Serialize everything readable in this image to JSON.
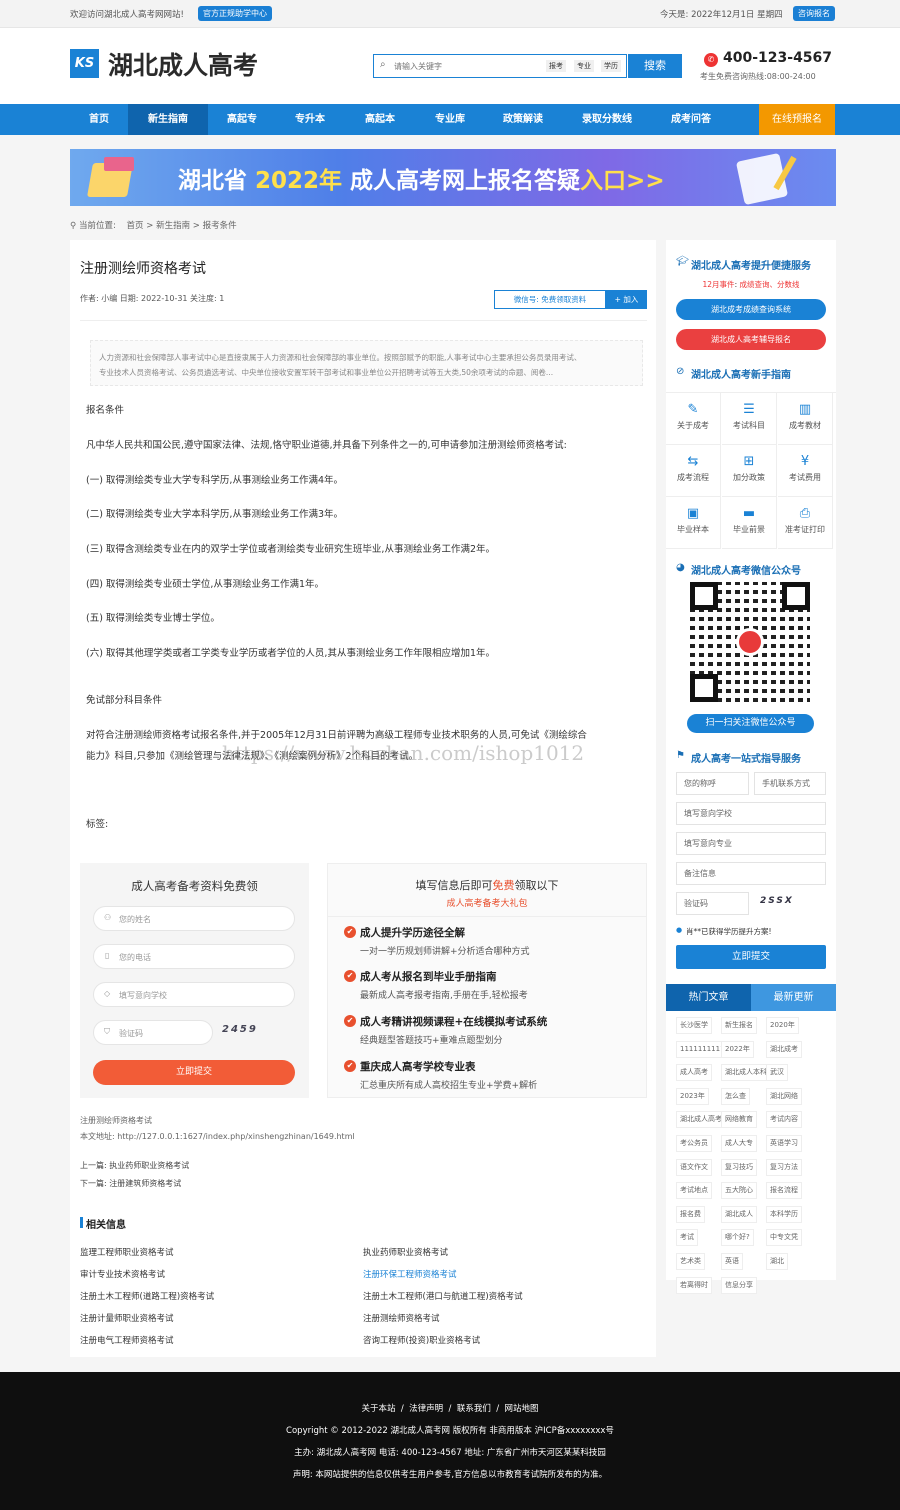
{
  "topbar": {
    "welcome": "欢迎访问湖北成人高考网网站!",
    "official_btn": "官方正规助学中心",
    "date": "今天是: 2022年12月1日 星期四",
    "consult_btn": "咨询报名"
  },
  "header": {
    "logo_mark": "KS",
    "site_name": "湖北成人高考",
    "search_placeholder": "请输入关键字",
    "search_tags": [
      "报考",
      "专业",
      "学历"
    ],
    "search_btn": "搜索",
    "phone": "400-123-4567",
    "hotline": "考生免费咨询热线:08:00-24:00"
  },
  "nav": {
    "items": [
      "首页",
      "新生指南",
      "高起专",
      "专升本",
      "高起本",
      "专业库",
      "政策解读",
      "录取分数线",
      "成考问答"
    ],
    "active_index": 1,
    "cta": "在线预报名"
  },
  "banner": {
    "text_prefix": "湖北省",
    "text_year": "2022年",
    "text_main": "成人高考网上报名答疑",
    "text_link": "入口>>"
  },
  "breadcrumb": {
    "label": "当前位置:",
    "home": "首页",
    "section": "新生指南",
    "current": "报考条件",
    "sep": ">"
  },
  "article": {
    "title": "注册测绘师资格考试",
    "meta": "作者: 小编 日期: 2022-10-31 关注度: 1",
    "wechat_label": "微信号: 免费领取资料",
    "add_btn": "+ 加入",
    "summary_lines": [
      "人力资源和社会保障部人事考试中心是直接隶属于人力资源和社会保障部的事业单位。按照部赋予的职能,人事考试中心主要承担公务员录用考试、",
      "专业技术人员资格考试、公务员遴选考试、中央单位接收安置军转干部考试和事业单位公开招聘考试等五大类,50余项考试的命题、阅卷..."
    ],
    "heading1": "报名条件",
    "intro": "凡中华人民共和国公民,遵守国家法律、法规,恪守职业道德,并具备下列条件之一的,可申请参加注册测绘师资格考试:",
    "conditions": [
      "(一) 取得测绘类专业大学专科学历,从事测绘业务工作满4年。",
      "(二) 取得测绘类专业大学本科学历,从事测绘业务工作满3年。",
      "(三) 取得含测绘类专业在内的双学士学位或者测绘类专业研究生班毕业,从事测绘业务工作满2年。",
      "(四) 取得测绘类专业硕士学位,从事测绘业务工作满1年。",
      "(五) 取得测绘类专业博士学位。",
      "(六) 取得其他理学类或者工学类专业学历或者学位的人员,其从事测绘业务工作年限相应增加1年。"
    ],
    "heading2": "免试部分科目条件",
    "exempt_line1": "对符合注册测绘师资格考试报名条件,并于2005年12月31日前评聘为高级工程师专业技术职务的人员,可免试《测绘综合",
    "exempt_line2": "能力》科目,只参加《测绘管理与法律法规》、《测绘案例分析》2个科目的考试。",
    "watermark": "https://www.huzhan.com/ishop1012",
    "tags_label": "标签:"
  },
  "form": {
    "title": "成人高考备考资料免费领",
    "name_ph": "您的姓名",
    "phone_ph": "您的电话",
    "school_ph": "填写意向学校",
    "captcha_ph": "验证码",
    "captcha_img": "2459",
    "submit": "立即提交"
  },
  "gifts": {
    "title_prefix": "填写信息后即可",
    "title_hl": "免费",
    "title_suffix": "领取以下",
    "subtitle": "成人高考备考大礼包",
    "items": [
      {
        "h": "成人提升学历途径全解",
        "d": "一对一学历规划师讲解+分析适合哪种方式"
      },
      {
        "h": "成人考从报名到毕业手册指南",
        "d": "最新成人高考报考指南,手册在手,轻松报考"
      },
      {
        "h": "成人考精讲视频课程+在线模拟考试系统",
        "d": "经典题型答题技巧+重难点题型划分"
      },
      {
        "h": "重庆成人高考学校专业表",
        "d": "汇总重庆所有成人高校招生专业+学费+解析"
      }
    ]
  },
  "meta_block": {
    "page_title": "注册测绘师资格考试",
    "address": "本文地址: http://127.0.0.1:1627/index.php/xinshengzhinan/1649.html",
    "prev": "上一篇: 执业药师职业资格考试",
    "next": "下一篇: 注册建筑师资格考试"
  },
  "related": {
    "title": "相关信息",
    "left": [
      "监理工程师职业资格考试",
      "审计专业技术资格考试",
      "注册土木工程师(道路工程)资格考试",
      "注册计量师职业资格考试",
      "注册电气工程师资格考试"
    ],
    "right": [
      "执业药师职业资格考试",
      "注册环保工程师资格考试",
      "注册土木工程师(港口与航道工程)资格考试",
      "注册测绘师资格考试",
      "咨询工程师(投资)职业资格考试"
    ]
  },
  "sidebar": {
    "service_title": "湖北成人高考提升便捷服务",
    "notice_month": "12月事件",
    "notice_links": "成绩查询、分数线",
    "query_btn": "湖北成考成绩查询系统",
    "coach_btn": "湖北成人高考辅导报名",
    "guide_title": "湖北成人高考新手指南",
    "grid": [
      {
        "icon": "✎",
        "label": "关于成考"
      },
      {
        "icon": "☰",
        "label": "考试科目"
      },
      {
        "icon": "▥",
        "label": "成考教材"
      },
      {
        "icon": "⇆",
        "label": "成考流程"
      },
      {
        "icon": "⊞",
        "label": "加分政策"
      },
      {
        "icon": "¥",
        "label": "考试费用"
      },
      {
        "icon": "▣",
        "label": "毕业样本"
      },
      {
        "icon": "▬",
        "label": "毕业前景"
      },
      {
        "icon": "⎙",
        "label": "准考证打印"
      }
    ],
    "wechat_title": "湖北成人高考微信公众号",
    "qr_btn": "扫一扫关注微信公众号",
    "onestop_title": "成人高考一站式指导服务",
    "fields": {
      "name": "您的称呼",
      "phone": "手机联系方式",
      "school": "填写意向学校",
      "major": "填写意向专业",
      "remark": "备注信息",
      "captcha": "验证码"
    },
    "captcha_img": "2SSX",
    "success_note": "肖**已获得学历提升方案!",
    "submit": "立即提交",
    "tab_hot": "热门文章",
    "tab_new": "最新更新",
    "tags": [
      "长沙医学",
      "新生报名",
      "2020年",
      "11111111111",
      "2022年",
      "湖北成考",
      "成人高考",
      "湖北成人本科",
      "武汉",
      "2023年",
      "怎么查",
      "湖北网络",
      "湖北成人高考",
      "网络教育",
      "考试内容",
      "考公务员",
      "成人大专",
      "英语学习",
      "语文作文",
      "复习技巧",
      "复习方法",
      "考试地点",
      "五大院心",
      "报名流程",
      "报名费",
      "湖北成人",
      "本科学历",
      "考试",
      "哪个好?",
      "中专文凭",
      "艺术类",
      "英语",
      "湖北",
      "若离得时",
      "信息分享"
    ]
  },
  "footer": {
    "links": [
      "关于本站",
      "法律声明",
      "联系我们",
      "网站地图"
    ],
    "copyright": "Copyright © 2012-2022 湖北成人高考网 版权所有 非商用版本   沪ICP备xxxxxxxx号",
    "host": "主办: 湖北成人高考网  电话: 400-123-4567  地址: 广东省广州市天河区某某科技园",
    "statement": "声明: 本网站提供的信息仅供考生用户参考,官方信息以市教育考试院所发布的为准。"
  }
}
